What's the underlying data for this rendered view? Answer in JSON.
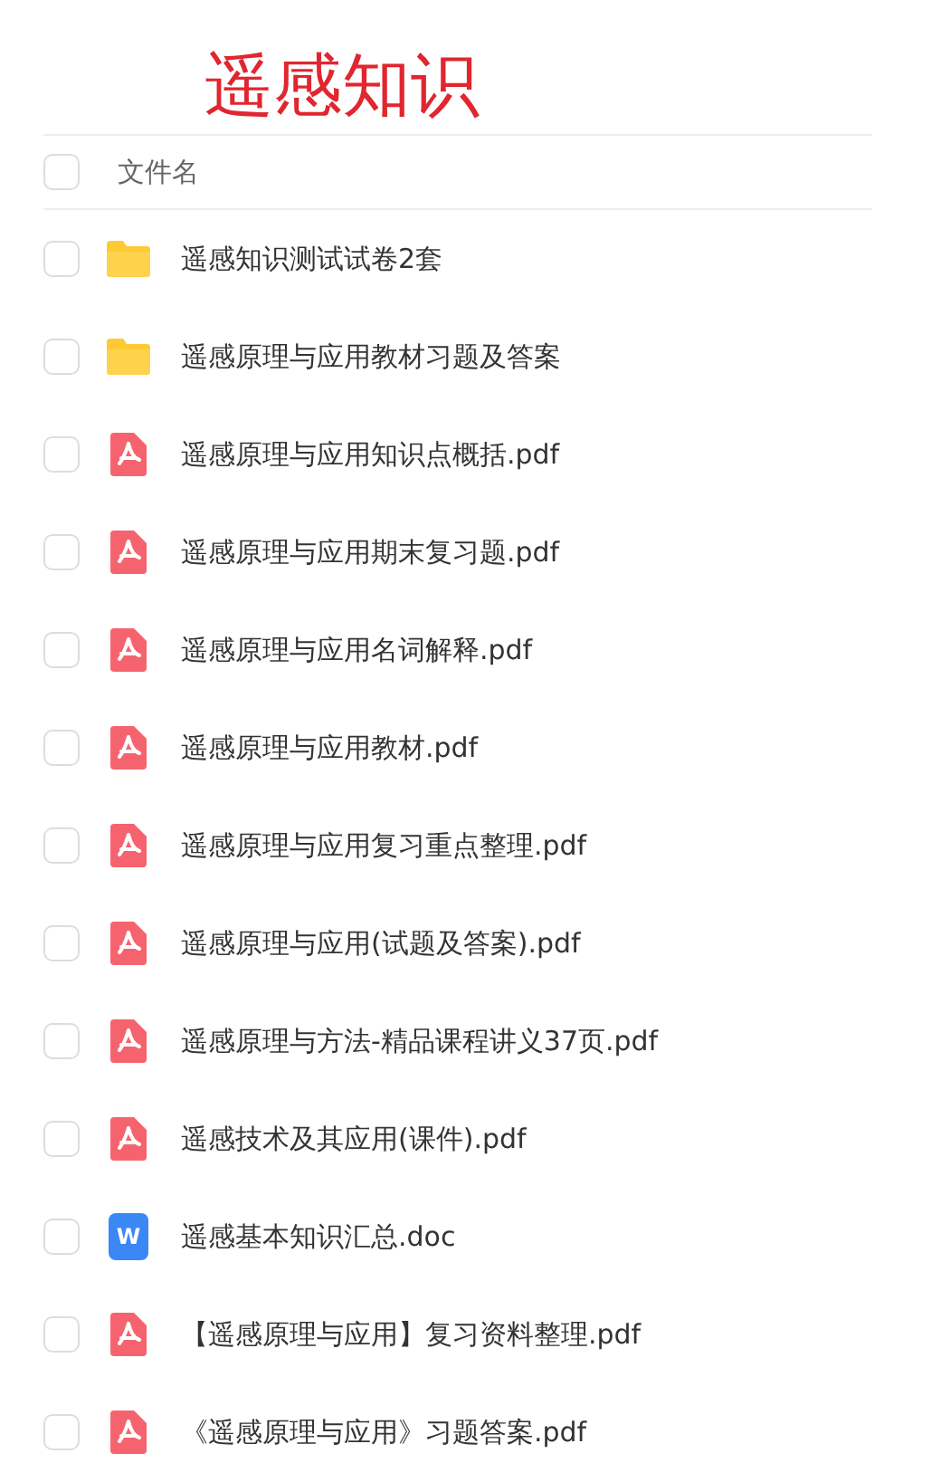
{
  "title": "遥感知识",
  "header": {
    "label": "文件名",
    "checked": false
  },
  "files": [
    {
      "kind": "folder",
      "name": "遥感知识测试试卷2套",
      "checked": false
    },
    {
      "kind": "folder",
      "name": "遥感原理与应用教材习题及答案",
      "checked": false
    },
    {
      "kind": "pdf",
      "name": "遥感原理与应用知识点概括.pdf",
      "checked": false
    },
    {
      "kind": "pdf",
      "name": "遥感原理与应用期末复习题.pdf",
      "checked": false
    },
    {
      "kind": "pdf",
      "name": "遥感原理与应用名词解释.pdf",
      "checked": false
    },
    {
      "kind": "pdf",
      "name": "遥感原理与应用教材.pdf",
      "checked": false
    },
    {
      "kind": "pdf",
      "name": "遥感原理与应用复习重点整理.pdf",
      "checked": false
    },
    {
      "kind": "pdf",
      "name": "遥感原理与应用(试题及答案).pdf",
      "checked": false
    },
    {
      "kind": "pdf",
      "name": "遥感原理与方法-精品课程讲义37页.pdf",
      "checked": false
    },
    {
      "kind": "pdf",
      "name": "遥感技术及其应用(课件).pdf",
      "checked": false
    },
    {
      "kind": "doc",
      "icon_text": "W",
      "name": "遥感基本知识汇总.doc",
      "checked": false
    },
    {
      "kind": "pdf",
      "name": "【遥感原理与应用】复习资料整理.pdf",
      "checked": false
    },
    {
      "kind": "pdf",
      "name": "《遥感原理与应用》习题答案.pdf",
      "checked": false
    }
  ]
}
